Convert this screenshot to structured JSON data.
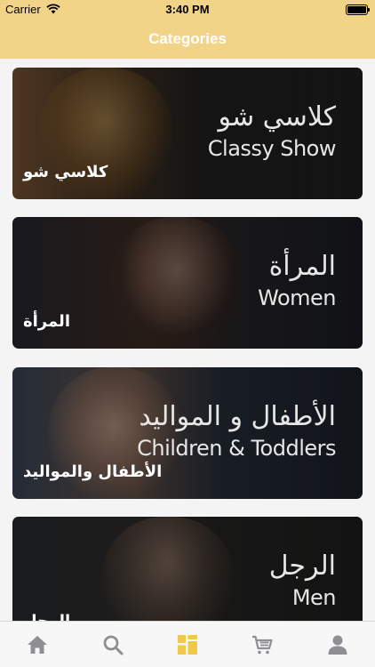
{
  "status_bar": {
    "carrier": "Carrier",
    "time": "3:40 PM"
  },
  "nav": {
    "title": "Categories"
  },
  "categories": [
    {
      "label": "كلاسي شو",
      "overlay_ar": "كلاسي شو",
      "overlay_en": "Classy Show"
    },
    {
      "label": "المرأة",
      "overlay_ar": "المرأة",
      "overlay_en": "Women"
    },
    {
      "label": "الأطفال والمواليد",
      "overlay_ar": "الأطفال و المواليد",
      "overlay_en": "Children & Toddlers"
    },
    {
      "label": "الرجل",
      "overlay_ar": "الرجل",
      "overlay_en": "Men"
    }
  ],
  "tab_bar": {
    "items": [
      {
        "icon": "home-icon"
      },
      {
        "icon": "search-icon"
      },
      {
        "icon": "categories-icon",
        "active": true
      },
      {
        "icon": "cart-icon"
      },
      {
        "icon": "profile-icon"
      }
    ],
    "active_color": "#f0c84a",
    "inactive_color": "#8e8e93"
  },
  "colors": {
    "accent": "#f2d489"
  }
}
